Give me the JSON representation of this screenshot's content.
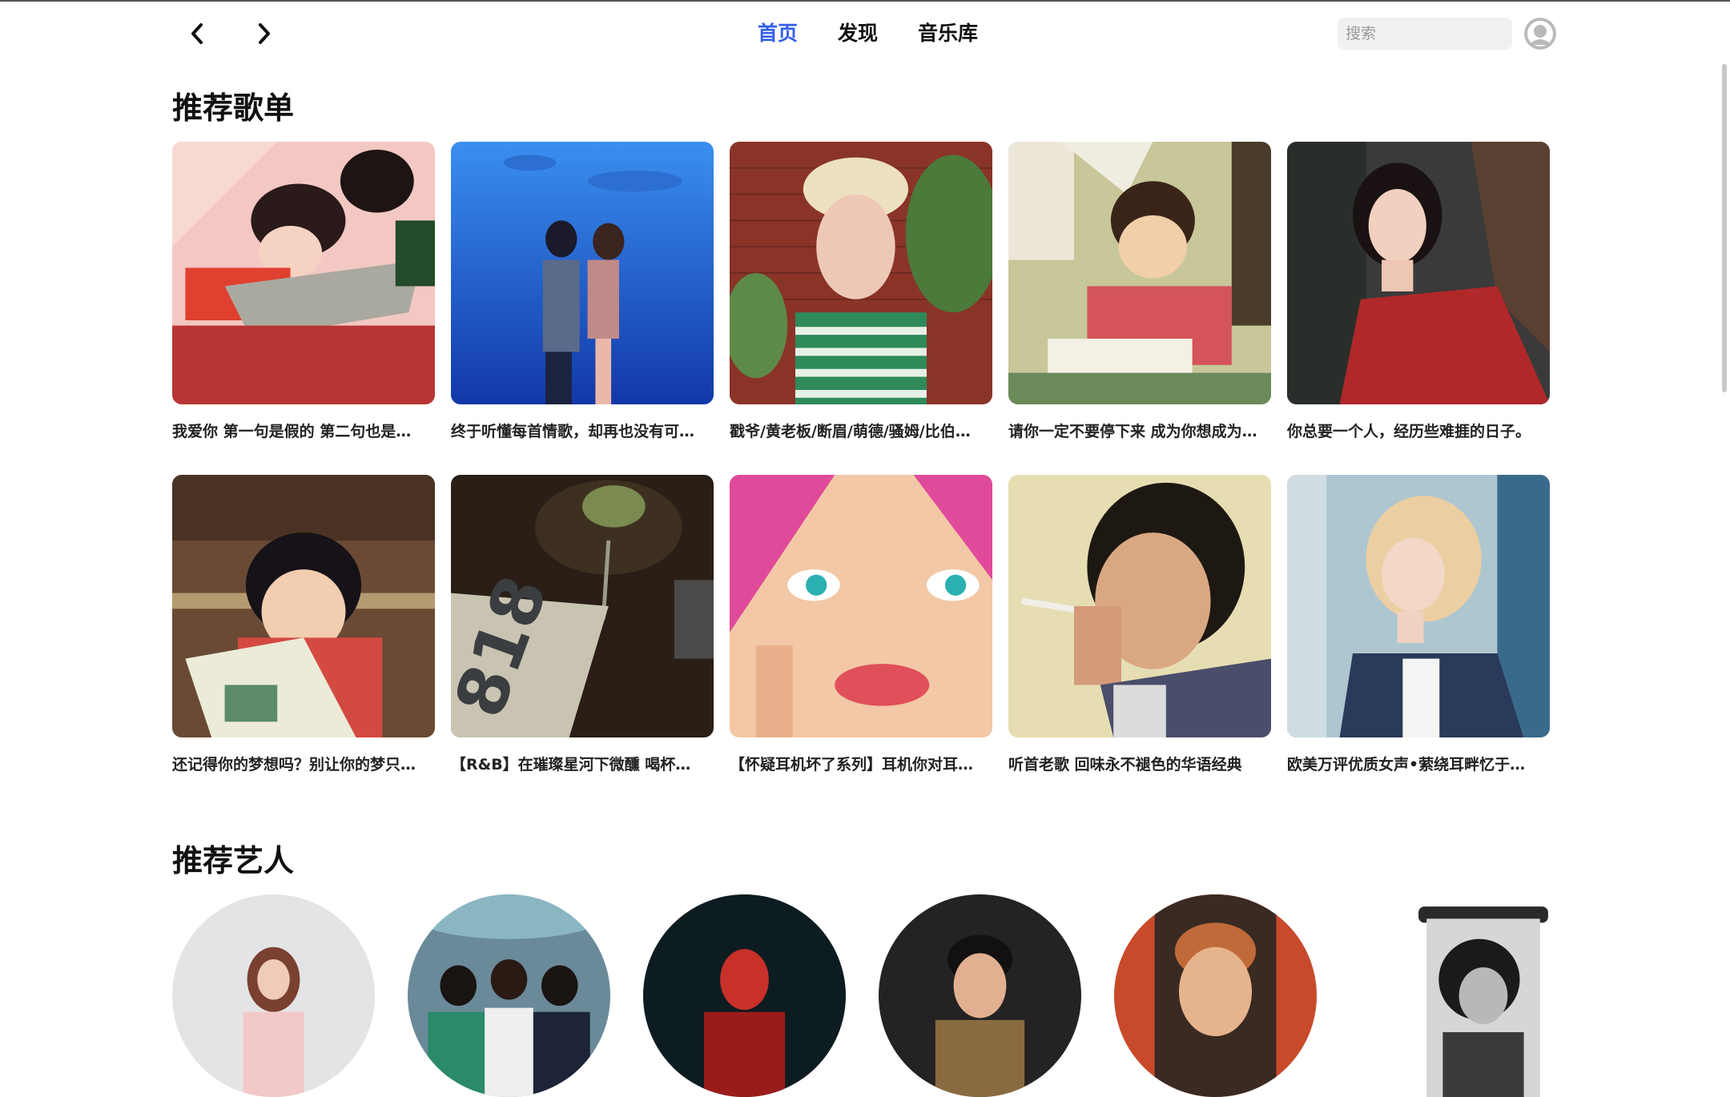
{
  "nav": {
    "tabs": [
      {
        "label": "首页",
        "active": true
      },
      {
        "label": "发现",
        "active": false
      },
      {
        "label": "音乐库",
        "active": false
      }
    ],
    "search_placeholder": "搜索",
    "accent_color": "#335eea"
  },
  "sections": {
    "playlists_title": "推荐歌单",
    "artists_title": "推荐艺人"
  },
  "playlists": [
    {
      "title": "我爱你 第一句是假的 第二句也是…",
      "cover": "illustration-couple-sleeping"
    },
    {
      "title": "终于听懂每首情歌，却再也没有可…",
      "cover": "aquarium-couple-kissing"
    },
    {
      "title": "戳爷/黄老板/断眉/萌德/骚姆/比伯…",
      "cover": "blond-man-striped-shirt"
    },
    {
      "title": "请你一定不要停下来 成为你想成为…",
      "cover": "anime-boy-studying"
    },
    {
      "title": "你总要一个人，经历些难捱的日子。",
      "cover": "woman-red-dress-tree"
    },
    {
      "title": "还记得你的梦想吗？别让你的梦只…",
      "cover": "anime-boy-reading-book"
    },
    {
      "title": "【R&B】在璀璨星河下微醺 喝杯…",
      "cover": "tequila-glass-coaster"
    },
    {
      "title": "【怀疑耳机坏了系列】耳机你对耳…",
      "cover": "pop-art-crying-woman"
    },
    {
      "title": "听首老歌 回味永不褪色的华语经典",
      "cover": "man-smoking-portrait"
    },
    {
      "title": "欧美万评优质女声•萦绕耳畔忆于…",
      "cover": "blonde-woman-portrait"
    }
  ],
  "artists": [
    {
      "name": "artist-1"
    },
    {
      "name": "artist-2"
    },
    {
      "name": "artist-3"
    },
    {
      "name": "artist-4"
    },
    {
      "name": "artist-5"
    },
    {
      "name": "artist-6"
    }
  ],
  "icons": {
    "back": "chevron-left-icon",
    "forward": "chevron-right-icon",
    "avatar": "user-avatar-icon"
  }
}
